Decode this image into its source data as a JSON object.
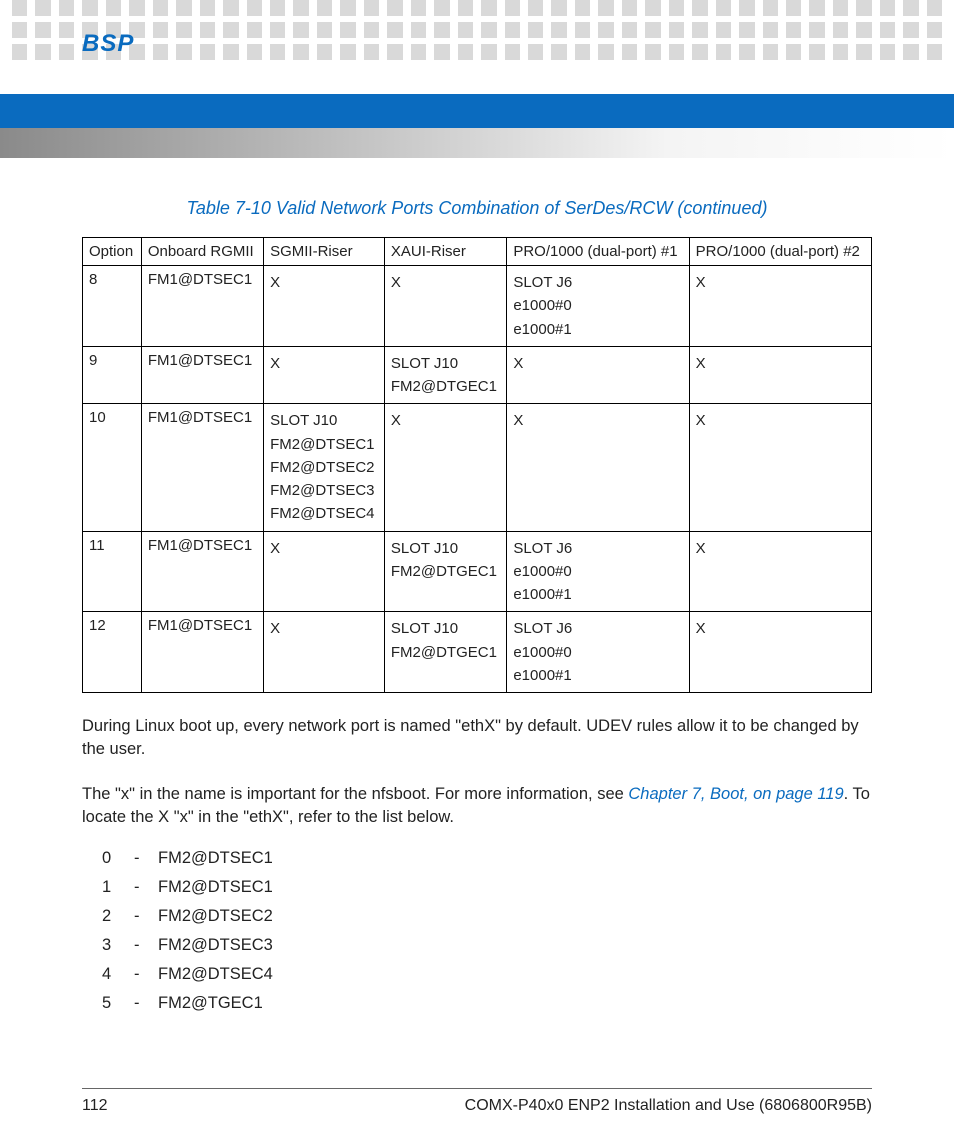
{
  "header": {
    "section_label": "BSP"
  },
  "table": {
    "caption": "Table 7-10 Valid Network Ports Combination of SerDes/RCW  (continued)",
    "headers": [
      "Option",
      "Onboard RGMII",
      "SGMII-Riser",
      "XAUI-Riser",
      "PRO/1000 (dual-port) #1",
      "PRO/1000 (dual-port) #2"
    ],
    "rows": [
      {
        "option": "8",
        "rgmii": "FM1@DTSEC1",
        "sgmii": [
          "X"
        ],
        "xaui": [
          "X"
        ],
        "pro1": [
          "SLOT J6",
          "e1000#0",
          "e1000#1"
        ],
        "pro2": [
          "X"
        ]
      },
      {
        "option": "9",
        "rgmii": "FM1@DTSEC1",
        "sgmii": [
          "X"
        ],
        "xaui": [
          "SLOT J10",
          "FM2@DTGEC1"
        ],
        "pro1": [
          "X"
        ],
        "pro2": [
          "X"
        ]
      },
      {
        "option": "10",
        "rgmii": "FM1@DTSEC1",
        "sgmii": [
          "SLOT J10",
          "FM2@DTSEC1",
          "FM2@DTSEC2",
          "FM2@DTSEC3",
          "FM2@DTSEC4"
        ],
        "xaui": [
          "X"
        ],
        "pro1": [
          "X"
        ],
        "pro2": [
          "X"
        ]
      },
      {
        "option": "11",
        "rgmii": "FM1@DTSEC1",
        "sgmii": [
          "X"
        ],
        "xaui": [
          "SLOT J10",
          "FM2@DTGEC1"
        ],
        "pro1": [
          "SLOT J6",
          "e1000#0",
          "e1000#1"
        ],
        "pro2": [
          "X"
        ]
      },
      {
        "option": "12",
        "rgmii": "FM1@DTSEC1",
        "sgmii": [
          "X"
        ],
        "xaui": [
          "SLOT J10",
          "FM2@DTGEC1"
        ],
        "pro1": [
          "SLOT J6",
          "e1000#0",
          "e1000#1"
        ],
        "pro2": [
          "X"
        ]
      }
    ]
  },
  "paragraphs": {
    "p1": "During Linux boot up, every network port is named \"ethX\" by default. UDEV rules allow it to be changed by the user.",
    "p2_pre": "The \"x\" in the name is important for the nfsboot. For more information, see ",
    "p2_link": "Chapter 7, Boot, on page 119",
    "p2_post": ". To locate the X \"x\" in the \"ethX\", refer to the list below."
  },
  "ethx_list": [
    {
      "idx": "0",
      "val": "FM2@DTSEC1"
    },
    {
      "idx": "1",
      "val": "FM2@DTSEC1"
    },
    {
      "idx": "2",
      "val": "FM2@DTSEC2"
    },
    {
      "idx": "3",
      "val": "FM2@DTSEC3"
    },
    {
      "idx": "4",
      "val": "FM2@DTSEC4"
    },
    {
      "idx": "5",
      "val": "FM2@TGEC1"
    }
  ],
  "footer": {
    "page_number": "112",
    "doc_title": "COMX-P40x0 ENP2 Installation and Use (6806800R95B)"
  }
}
